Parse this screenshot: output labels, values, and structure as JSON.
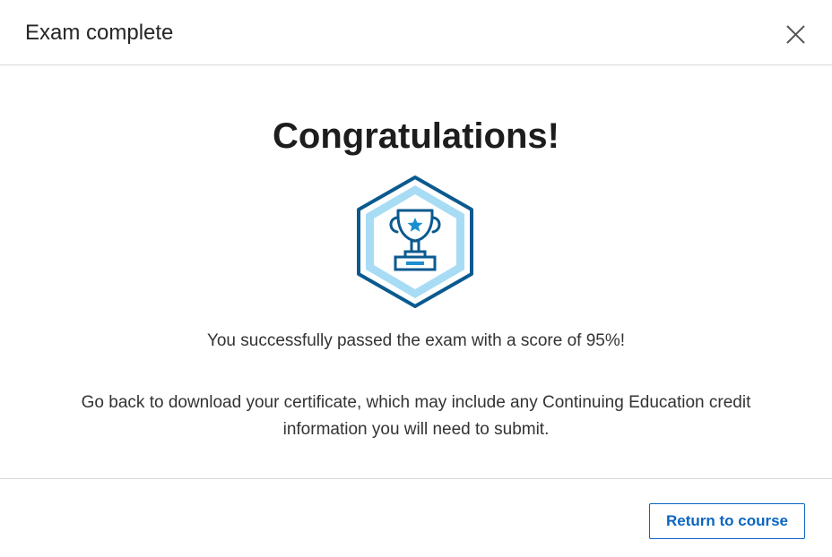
{
  "dialog": {
    "title": "Exam complete",
    "close_icon": "close-icon"
  },
  "content": {
    "heading": "Congratulations!",
    "badge_icon": "trophy-badge-icon",
    "score_message": "You successfully passed the exam with a score of 95%!",
    "score_percent": 95,
    "info_message": "Go back to download your certificate, which may include any Continuing Education credit information you will need to submit."
  },
  "footer": {
    "return_label": "Return to course"
  },
  "colors": {
    "accent": "#0a66c2",
    "badge_dark": "#0b5a8f",
    "badge_light": "#a8dcf5",
    "star": "#1a90d1",
    "divider": "#d9d9d9"
  }
}
